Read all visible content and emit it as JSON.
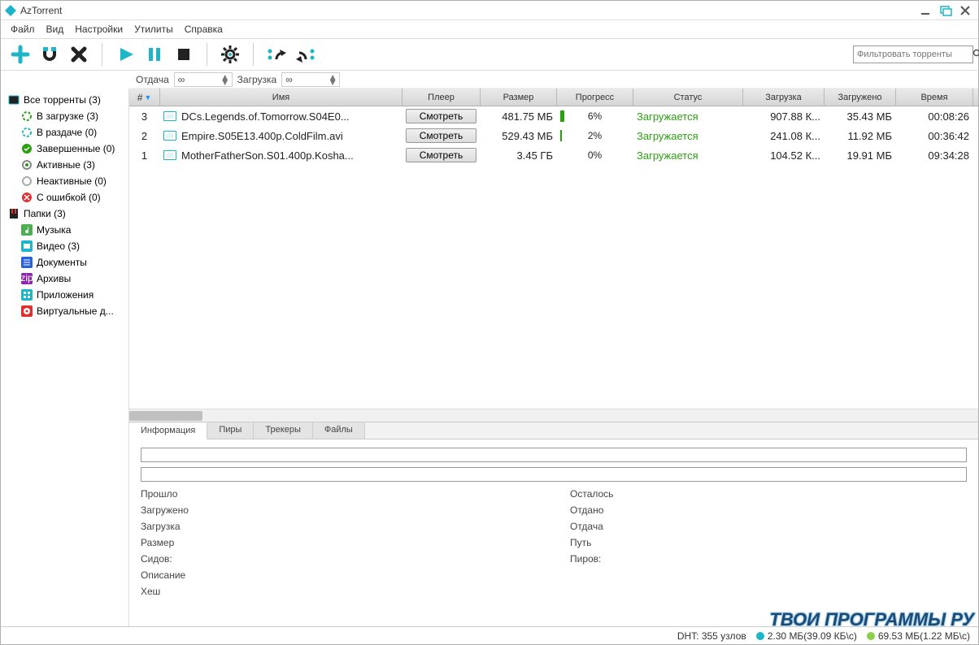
{
  "title": "AzTorrent",
  "menu": [
    "Файл",
    "Вид",
    "Настройки",
    "Утилиты",
    "Справка"
  ],
  "filter_placeholder": "Фильтровать торренты",
  "speed": {
    "upload_label": "Отдача",
    "download_label": "Загрузка",
    "infinity": "∞"
  },
  "sidebar": {
    "all": {
      "label": "Все торренты (3)"
    },
    "downloading": {
      "label": "В загрузке (3)"
    },
    "seeding": {
      "label": "В раздаче (0)"
    },
    "completed": {
      "label": "Завершенные (0)"
    },
    "active": {
      "label": "Активные (3)"
    },
    "inactive": {
      "label": "Неактивные (0)"
    },
    "errored": {
      "label": "С ошибкой (0)"
    },
    "folders": {
      "label": "Папки (3)"
    },
    "music": {
      "label": "Музыка"
    },
    "video": {
      "label": "Видео (3)"
    },
    "docs": {
      "label": "Документы"
    },
    "archives": {
      "label": "Архивы"
    },
    "apps": {
      "label": "Приложения"
    },
    "vdisks": {
      "label": "Виртуальные д..."
    }
  },
  "columns": {
    "num": "#",
    "name": "Имя",
    "player": "Плеер",
    "size": "Размер",
    "progress": "Прогресс",
    "status": "Статус",
    "download": "Загрузка",
    "loaded": "Загружено",
    "time": "Время"
  },
  "rows": [
    {
      "num": "3",
      "name": "DCs.Legends.of.Tomorrow.S04E0...",
      "play": "Смотреть",
      "size": "481.75 МБ",
      "progress": "6%",
      "progpx": 6,
      "status": "Загружается",
      "down": "907.88 К...",
      "loaded": "35.43 МБ",
      "time": "00:08:26"
    },
    {
      "num": "2",
      "name": "Empire.S05E13.400p.ColdFilm.avi",
      "play": "Смотреть",
      "size": "529.43 МБ",
      "progress": "2%",
      "progpx": 2,
      "status": "Загружается",
      "down": "241.08 К...",
      "loaded": "11.92 МБ",
      "time": "00:36:42"
    },
    {
      "num": "1",
      "name": "MotherFatherSon.S01.400p.Kosha...",
      "play": "Смотреть",
      "size": "3.45 ГБ",
      "progress": "0%",
      "progpx": 0,
      "status": "Загружается",
      "down": "104.52 К...",
      "loaded": "19.91 МБ",
      "time": "09:34:28"
    }
  ],
  "bottom_tabs": [
    "Информация",
    "Пиры",
    "Трекеры",
    "Файлы"
  ],
  "info": {
    "left": [
      "Прошло",
      "Загружено",
      "Загрузка",
      "Размер",
      "Сидов:",
      "Описание",
      "Хеш"
    ],
    "right": [
      "Осталось",
      "Отдано",
      "Отдача",
      "Путь",
      "Пиров:"
    ]
  },
  "status": {
    "dht": "DHT: 355 узлов",
    "down": "2.30 МБ(39.09 КБ\\с)",
    "up": "69.53 МБ(1.22 МБ\\с)"
  },
  "watermark": "ТВОИ ПРОГРАММЫ РУ"
}
